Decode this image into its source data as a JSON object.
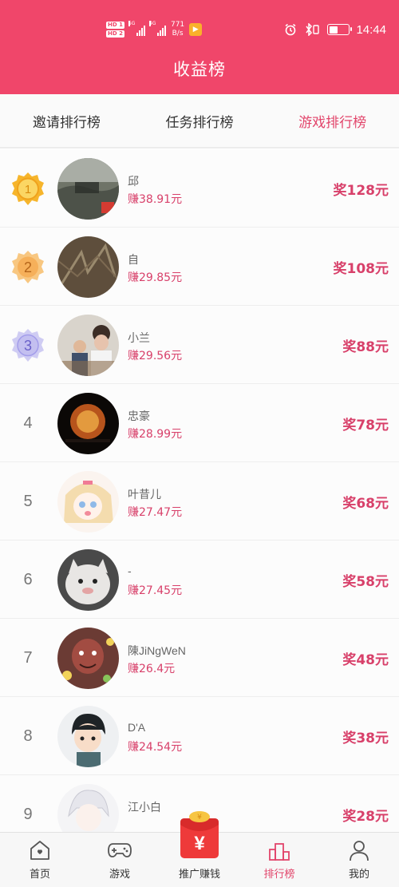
{
  "status_bar": {
    "hd1": "HD 1",
    "hd2": "HD 2",
    "signal1": "5G",
    "signal2": "4G",
    "net_speed_value": "771",
    "net_speed_unit": "B/s",
    "time": "14:44"
  },
  "header": {
    "title": "收益榜"
  },
  "tabs": [
    {
      "label": "邀请排行榜",
      "active": false
    },
    {
      "label": "任务排行榜",
      "active": false
    },
    {
      "label": "游戏排行榜",
      "active": true
    }
  ],
  "ranking": [
    {
      "rank": "1",
      "name": "邱",
      "earn": "赚38.91元",
      "reward": "奖128元"
    },
    {
      "rank": "2",
      "name": "自",
      "earn": "赚29.85元",
      "reward": "奖108元"
    },
    {
      "rank": "3",
      "name": "小兰",
      "earn": "赚29.56元",
      "reward": "奖88元"
    },
    {
      "rank": "4",
      "name": "忠豪",
      "earn": "赚28.99元",
      "reward": "奖78元"
    },
    {
      "rank": "5",
      "name": "叶昔儿",
      "earn": "赚27.47元",
      "reward": "奖68元"
    },
    {
      "rank": "6",
      "name": "-",
      "earn": "赚27.45元",
      "reward": "奖58元"
    },
    {
      "rank": "7",
      "name": "陳JiNgWeN",
      "earn": "赚26.4元",
      "reward": "奖48元"
    },
    {
      "rank": "8",
      "name": "D'A",
      "earn": "赚24.54元",
      "reward": "奖38元"
    },
    {
      "rank": "9",
      "name": "江小白",
      "earn": "",
      "reward": "奖28元"
    }
  ],
  "bottom_nav": [
    {
      "label": "首页",
      "icon": "home-icon",
      "active": false
    },
    {
      "label": "游戏",
      "icon": "gamepad-icon",
      "active": false
    },
    {
      "label": "推广赚钱",
      "icon": "red-envelope-icon",
      "active": false
    },
    {
      "label": "排行榜",
      "icon": "podium-icon",
      "active": true
    },
    {
      "label": "我的",
      "icon": "user-icon",
      "active": false
    }
  ],
  "colors": {
    "brand": "#f0466a",
    "accent_text": "#d8406a",
    "gold": "#f6b52c",
    "silver_orange": "#f5a848",
    "bronze_lavender": "#b8b3ec"
  }
}
